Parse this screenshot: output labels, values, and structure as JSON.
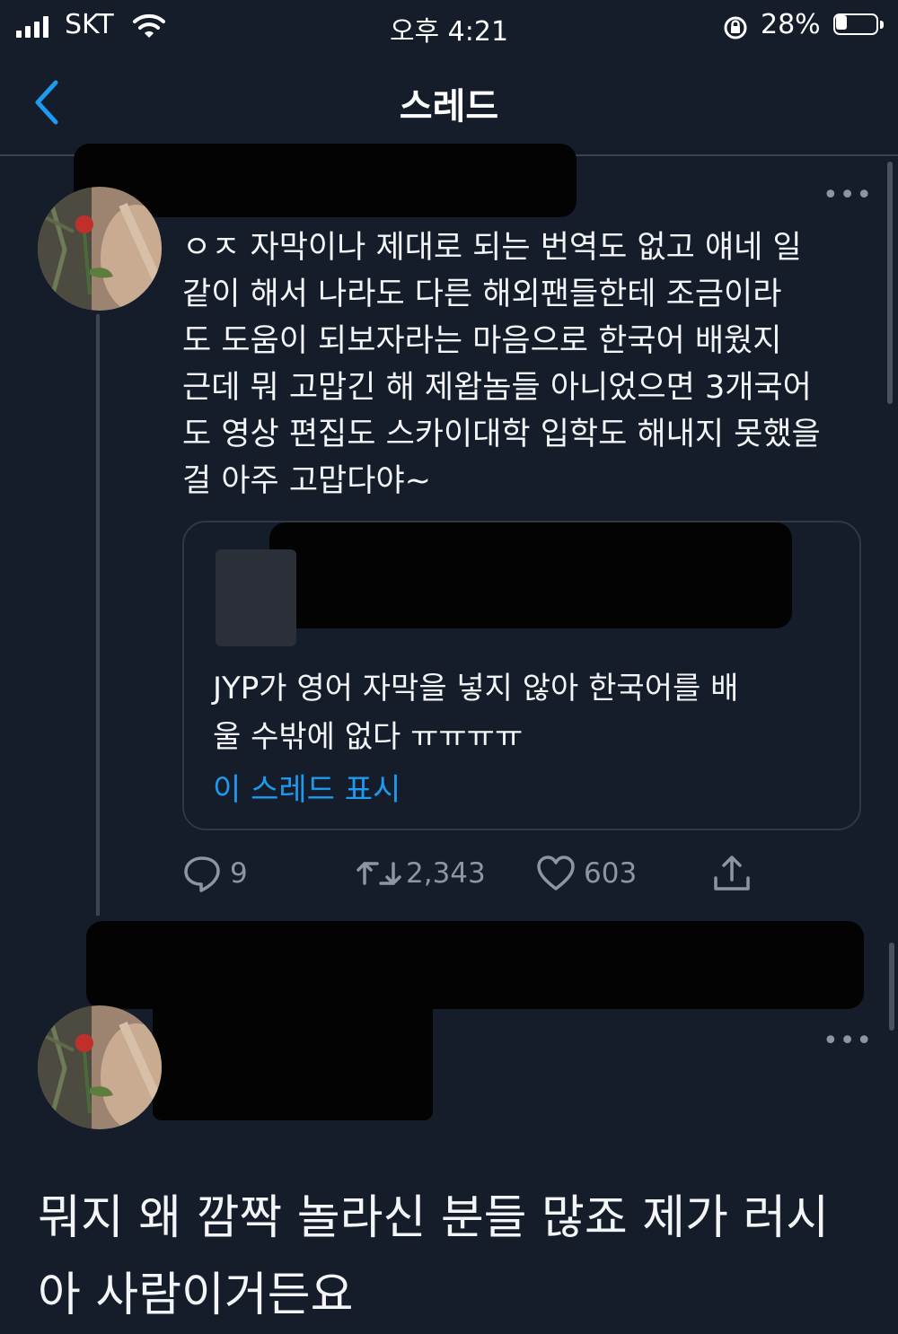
{
  "status_bar": {
    "carrier": "SKT",
    "time": "오후 4:21",
    "battery": "28%"
  },
  "nav": {
    "title": "스레드"
  },
  "tweet": {
    "lines": [
      "ㅇㅈ 자막이나 제대로 되는 번역도 없고 얘네 일",
      "같이 해서 나라도 다른 해외팬들한테 조금이라",
      "도 도움이 되보자라는 마음으로 한국어 배웠지",
      "근데 뭐 고맙긴 해 제왑놈들 아니었으면 3개국어",
      "도 영상 편집도 스카이대학 입학도 해내지 못했을",
      "걸 아주 고맙다야~"
    ],
    "quote": {
      "lines": [
        "JYP가 영어 자막을 넣지 않아 한국어를 배",
        "울 수밖에 없다 ㅠㅠㅠㅠ"
      ],
      "show_thread": "이 스레드 표시"
    },
    "actions": {
      "replies": "9",
      "retweets": "2,343",
      "likes": "603"
    }
  },
  "reply": {
    "lines": [
      "뭐지 왜 깜짝 놀라신 분들 많죠 제가 러시",
      "아 사람이거든요"
    ]
  },
  "colors": {
    "background": "#151c2a",
    "accent": "#1d9bf0",
    "muted": "#8b96a3"
  },
  "icons": {
    "back": "chevron-left-icon",
    "reply": "speech-bubble-icon",
    "retweet": "retweet-icon",
    "like": "heart-icon",
    "share": "share-icon"
  }
}
